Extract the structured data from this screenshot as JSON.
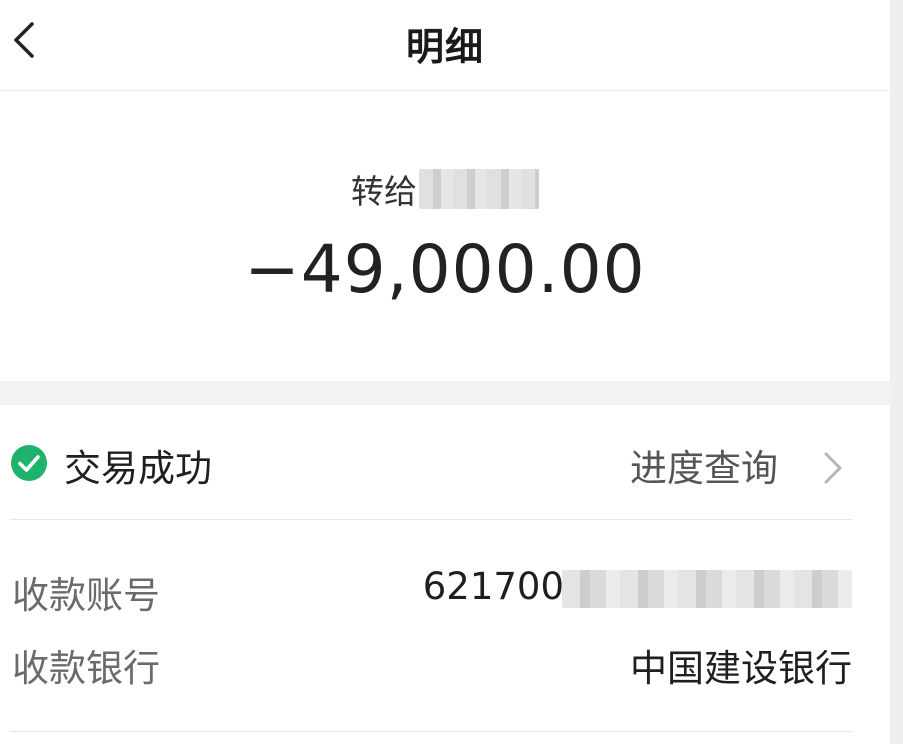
{
  "header": {
    "title": "明细",
    "back_icon": "chevron-left-icon"
  },
  "summary": {
    "transfer_prefix": "转给",
    "amount": "−49,000.00"
  },
  "status": {
    "icon": "check-circle-icon",
    "icon_color": "#1db36a",
    "text": "交易成功",
    "progress_link": "进度查询",
    "chevron_icon": "chevron-right-icon"
  },
  "details": {
    "account_label": "收款账号",
    "account_value_prefix": "621700",
    "bank_label": "收款银行",
    "bank_value": "中国建设银行"
  }
}
